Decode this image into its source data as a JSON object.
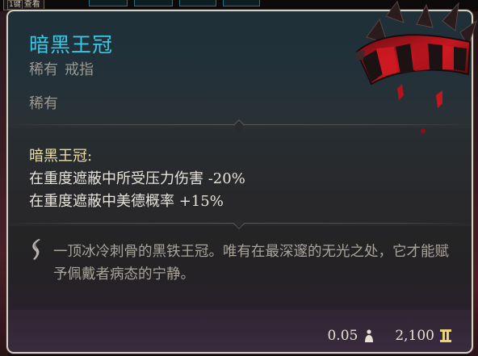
{
  "hud": {
    "key_hint": "1键",
    "key_label": "查看"
  },
  "item": {
    "name": "暗黑王冠",
    "rarity_label": "稀有",
    "item_type": "戒指",
    "rarity_line": "稀有",
    "effects_header": "暗黑王冠:",
    "effects": [
      "在重度遮蔽中所受压力伤害 -20%",
      "在重度遮蔽中美德概率 +15%"
    ],
    "description": "一顶冰冷刺骨的黑铁王冠。唯有在最深邃的无光之处，它才能赋予佩戴者病态的宁静。",
    "weight": "0.05",
    "value": "2,100"
  },
  "icons": {
    "description": "quill-icon",
    "weight": "weight-icon",
    "value": "gold-icon",
    "item": "dark-crown-icon"
  },
  "colors": {
    "title": "#3ac7e6",
    "effects_header": "#eadfa8",
    "text": "#e8e4dc",
    "muted": "#9b9890",
    "frame": "#d9cfc0"
  }
}
